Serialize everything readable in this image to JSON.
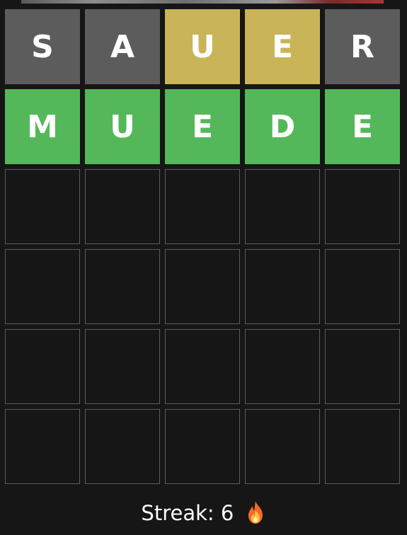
{
  "colors": {
    "background": "#161616",
    "absent": "#5c5c5c",
    "present": "#c9b458",
    "correct": "#54b85a",
    "empty_border": "#5c5c5c",
    "text": "#ffffff"
  },
  "board": {
    "rows": [
      [
        {
          "letter": "S",
          "state": "absent"
        },
        {
          "letter": "A",
          "state": "absent"
        },
        {
          "letter": "U",
          "state": "present"
        },
        {
          "letter": "E",
          "state": "present"
        },
        {
          "letter": "R",
          "state": "absent"
        }
      ],
      [
        {
          "letter": "M",
          "state": "correct"
        },
        {
          "letter": "U",
          "state": "correct"
        },
        {
          "letter": "E",
          "state": "correct"
        },
        {
          "letter": "D",
          "state": "correct"
        },
        {
          "letter": "E",
          "state": "correct"
        }
      ],
      [
        {
          "letter": "",
          "state": "empty"
        },
        {
          "letter": "",
          "state": "empty"
        },
        {
          "letter": "",
          "state": "empty"
        },
        {
          "letter": "",
          "state": "empty"
        },
        {
          "letter": "",
          "state": "empty"
        }
      ],
      [
        {
          "letter": "",
          "state": "empty"
        },
        {
          "letter": "",
          "state": "empty"
        },
        {
          "letter": "",
          "state": "empty"
        },
        {
          "letter": "",
          "state": "empty"
        },
        {
          "letter": "",
          "state": "empty"
        }
      ],
      [
        {
          "letter": "",
          "state": "empty"
        },
        {
          "letter": "",
          "state": "empty"
        },
        {
          "letter": "",
          "state": "empty"
        },
        {
          "letter": "",
          "state": "empty"
        },
        {
          "letter": "",
          "state": "empty"
        }
      ],
      [
        {
          "letter": "",
          "state": "empty"
        },
        {
          "letter": "",
          "state": "empty"
        },
        {
          "letter": "",
          "state": "empty"
        },
        {
          "letter": "",
          "state": "empty"
        },
        {
          "letter": "",
          "state": "empty"
        }
      ]
    ]
  },
  "streak": {
    "label": "Streak: 6",
    "icon": "fire-icon"
  }
}
